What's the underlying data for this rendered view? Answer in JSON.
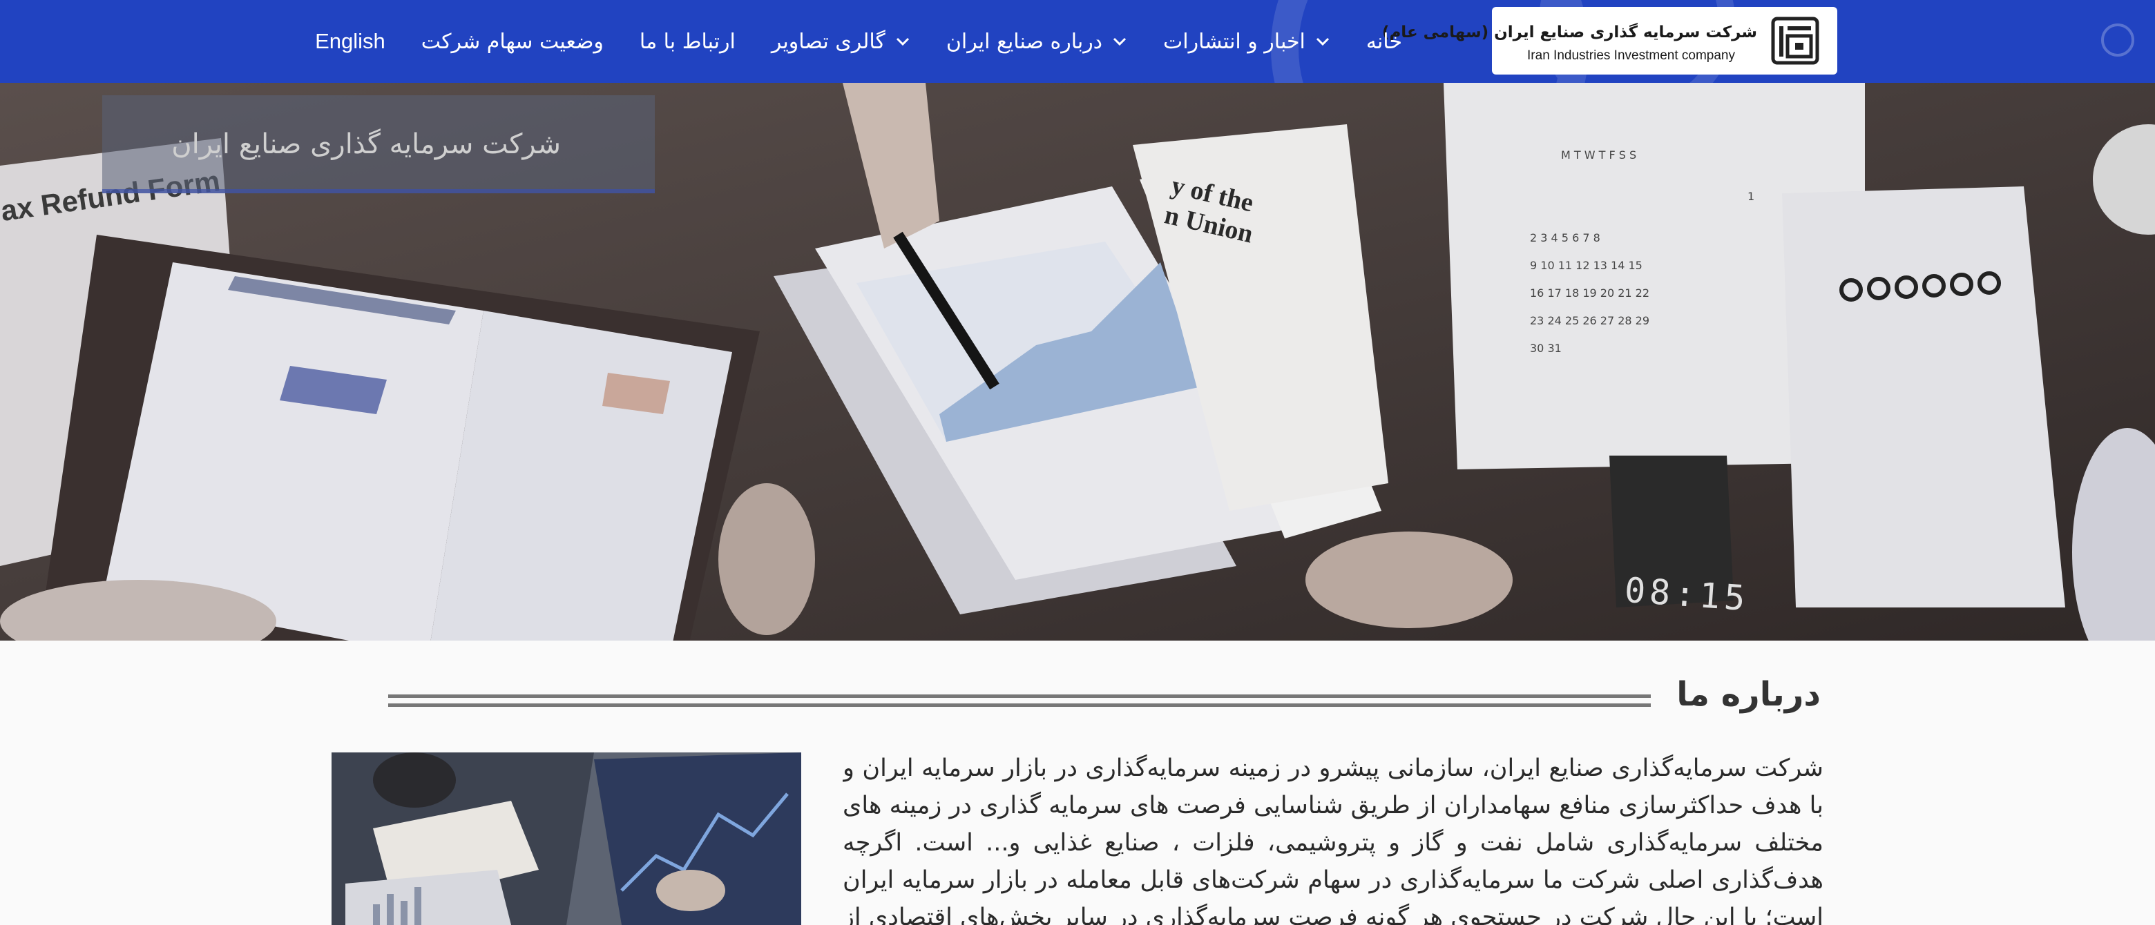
{
  "brand": {
    "name_fa": "شرکت سرمایه گذاری صنایع ایران (سهامی عام)",
    "name_en": "Iran Industries Investment company",
    "logo_icon": "iiic-logo-icon"
  },
  "nav": {
    "items": [
      {
        "label": "خانه",
        "dropdown": false
      },
      {
        "label": "اخبار و انتشارات",
        "dropdown": true
      },
      {
        "label": "درباره صنایع ایران",
        "dropdown": true
      },
      {
        "label": "گالری تصاویر",
        "dropdown": true
      },
      {
        "label": "ارتباط با ما",
        "dropdown": false
      },
      {
        "label": "وضعیت سهام شرکت",
        "dropdown": false
      },
      {
        "label": "English",
        "dropdown": false
      }
    ]
  },
  "hero": {
    "caption": "شرکت سرمایه گذاری صنایع ایران",
    "photo_text": {
      "form": "ax Refund Form",
      "newspaper_line1": "y of the",
      "newspaper_line2": "n Union",
      "clock": "08:15"
    }
  },
  "about": {
    "title": "درباره ما",
    "body": "شرکت سرمایه‌گذاری صنایع ایران، سازمانی پیشرو در زمینه سرمایه‌گذاری در بازار سرمایه ایران و با هدف حداکثرسازی منافع سهامداران از طریق شناسایی فرصت های سرمایه گذاری در زمینه های مختلف سرمایه‌گذاری شامل نفت و گاز و پتروشیمی، فلزات ، صنایع غذایی و... است. اگرچه هدف‌گذاری اصلی شرکت ما سرمایه‌گذاری در سهام شرکت‌های قابل معامله در بازار سرمایه ایران است؛ با این حال شرکت در جستجوی هر گونه فرصت سرمایه‌گذاری در سایر بخش‌های اقتصادی از جمله"
  },
  "colors": {
    "navbar": "#2143c1",
    "page_bg": "#fafafa",
    "text": "#2a2a2a"
  }
}
